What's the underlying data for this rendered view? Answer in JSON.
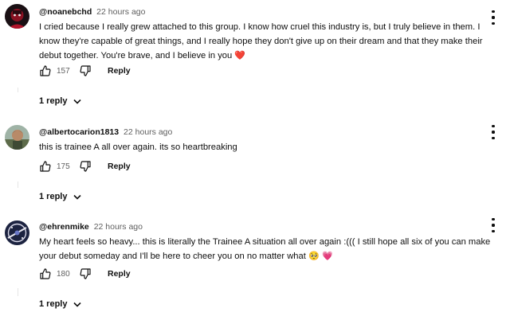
{
  "comments": [
    {
      "handle": "@noanebchd",
      "time": "22 hours ago",
      "text": "I cried because I really grew attached to this group. I know how cruel this industry is, but I truly believe in them. I know they're capable of great things, and I really hope they don't give up on their dream and that they make their debut together. You're brave, and I believe in you",
      "emoji": "❤️",
      "likes": "157",
      "reply_label": "Reply",
      "replies_label": "1 reply"
    },
    {
      "handle": "@albertocarion1813",
      "time": "22 hours ago",
      "text": "this is trainee A all over again. its so heartbreaking",
      "emoji": "",
      "likes": "175",
      "reply_label": "Reply",
      "replies_label": "1 reply"
    },
    {
      "handle": "@ehrenmike",
      "time": "22 hours ago",
      "text": "My heart feels so heavy... this is literally the Trainee A situation all over again :((( I still hope all six of you can make your debut someday and I'll be here to cheer you on no matter what",
      "emoji": "🥺 💗",
      "likes": "180",
      "reply_label": "Reply",
      "replies_label": "1 reply"
    }
  ],
  "colors": {
    "text": "#0f0f0f",
    "secondary": "#606060",
    "heart": "#e0245e",
    "pink_heart": "#f25a9c"
  },
  "icons": [
    "thumbs-up-icon",
    "thumbs-down-icon",
    "chevron-down-icon",
    "more-vertical-icon",
    "avatar"
  ]
}
